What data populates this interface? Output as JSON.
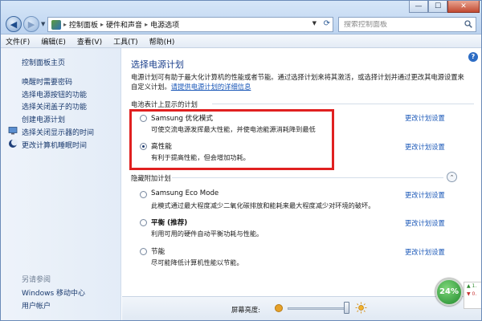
{
  "window": {
    "controls": {
      "minimize": "—",
      "maximize": "☐",
      "close": "✕"
    }
  },
  "address": {
    "crumbs": [
      "控制面板",
      "硬件和声音",
      "电源选项"
    ],
    "separator": "▸"
  },
  "search": {
    "placeholder": "搜索控制面板"
  },
  "menu": [
    "文件(F)",
    "编辑(E)",
    "查看(V)",
    "工具(T)",
    "帮助(H)"
  ],
  "sidebar": {
    "home": "控制面板主页",
    "links": [
      {
        "label": "唤醒时需要密码",
        "icon": ""
      },
      {
        "label": "选择电源按钮的功能",
        "icon": ""
      },
      {
        "label": "选择关闭盖子的功能",
        "icon": ""
      },
      {
        "label": "创建电源计划",
        "icon": ""
      },
      {
        "label": "选择关闭显示器的时间",
        "icon": "monitor-icon"
      },
      {
        "label": "更改计算机睡眠时间",
        "icon": "moon-icon"
      }
    ],
    "see_also": "另请参阅",
    "see_also_links": [
      "Windows 移动中心",
      "用户帐户"
    ]
  },
  "main": {
    "title": "选择电源计划",
    "intro_part1": "电源计划可有助于最大化计算机的性能或者节能。通过选择计划来将其激活，或选择计划并通过更改其电源设置来自定义计划。",
    "intro_link": "请提供电源计划的详细信息",
    "battery_meter_section": "电池表计上显示的计划",
    "hidden_section": "隐藏附加计划",
    "change_link": "更改计划设置",
    "plans_shown": [
      {
        "name": "Samsung 优化模式",
        "desc": "可使交流电源发挥最大性能，并使电池能源消耗降到最低",
        "selected": false
      },
      {
        "name": "高性能",
        "desc": "有利于提高性能，但会增加功耗。",
        "selected": true
      }
    ],
    "plans_hidden": [
      {
        "name": "Samsung Eco Mode",
        "desc": "此模式通过最大程度减少二氧化碳排放和能耗来最大程度减少对环境的破坏。",
        "selected": false
      },
      {
        "name": "平衡 (推荐)",
        "desc": "利用可用的硬件自动平衡功耗与性能。",
        "selected": false
      },
      {
        "name": "节能",
        "desc": "尽可能降低计算机性能以节能。",
        "selected": false
      }
    ]
  },
  "bottom": {
    "brightness_label": "屏幕亮度:"
  },
  "battery_gadget": {
    "percent": "24%",
    "line1": "1.",
    "line2": "0."
  },
  "colors": {
    "link": "#1b58b8",
    "title": "#1a3f8c",
    "highlight_box": "#e02020"
  }
}
